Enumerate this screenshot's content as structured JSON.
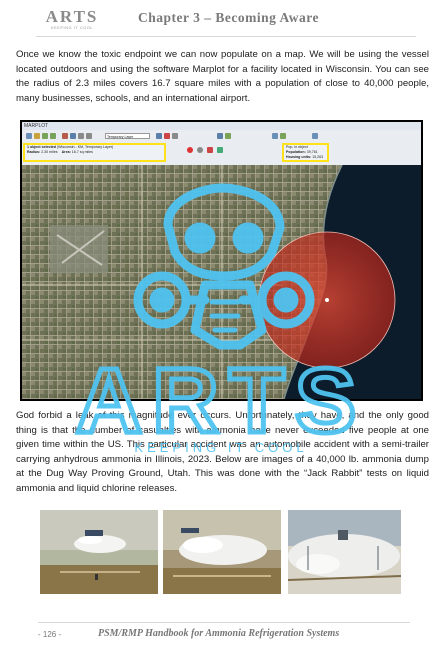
{
  "header": {
    "logo_text": "ARTS",
    "logo_tagline": "KEEPING IT COOL",
    "chapter_title": "Chapter 3 – Becoming Aware"
  },
  "paragraphs": {
    "p1": "Once we know the toxic endpoint we can now populate on a map.  We will be using the vessel located outdoors and using the software Marplot for a facility located in Wisconsin.  You can see the radius of 2.3 miles covers 16.7 square miles with a population of close to 40,000 people, many businesses, schools, and an international airport.",
    "p2": "God forbid a leak of this magnitude ever occurs. Unfortunately, they have, and the only good thing is that the number of casualties with ammonia have never exceeded five people at one given time within the US.  This particular accident was an automobile accident with a semi-trailer carrying anhydrous ammonia in Illinois, 2023.  Below are images of a 40,000 lb. ammonia dump at the Dug Way Proving Ground, Utah.  This was done with the “Jack Rabbit” tests on liquid ammonia and liquid chlorine releases."
  },
  "screenshot": {
    "window_title": "MARPLOT",
    "layer_dropdown": "Temporary Layer",
    "object_info": {
      "selected": "1 object selected",
      "selected_detail": "(Wisconsin - KM, Temporary Layer)",
      "radius_label": "Radius:",
      "radius_value": "2.30 miles",
      "area_label": "Area:",
      "area_value": "16.7 sq miles"
    },
    "population_info": {
      "heading": "Pop. in object",
      "population_label": "Population:",
      "population_value": "39,761",
      "housing_label": "Housing units:",
      "housing_value": "15,263"
    }
  },
  "footer": {
    "page_number": "- 126 -",
    "title": "PSM/RMP Handbook for Ammonia Refrigeration Systems"
  },
  "watermark": {
    "text": "ARTS",
    "tagline": "KEEPING IT COOL",
    "color": "#4fc3f0"
  },
  "colors": {
    "highlight_box": "#ffe21a",
    "threat_zone": "#d93a2b",
    "lake": "#0d1c2a"
  }
}
